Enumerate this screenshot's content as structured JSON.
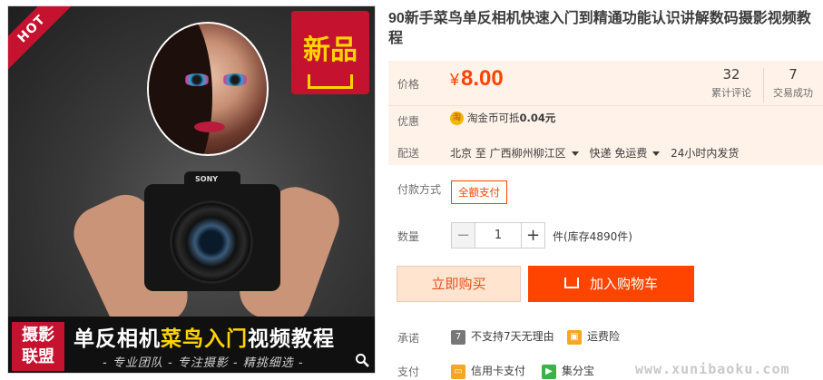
{
  "image": {
    "hot_label": "HOT",
    "new_label": "新品",
    "camera_brand": "SONY",
    "banner_tag": [
      "摄影",
      "联盟"
    ],
    "banner_title_white_1": "单反相机",
    "banner_title_yellow": "菜鸟入门",
    "banner_title_white_2": "视频教程",
    "banner_subtitle": "- 专业团队 - 专注摄影 - 精挑细选 -"
  },
  "product": {
    "title": "90新手菜鸟单反相机快速入门到精通功能认识讲解数码摄影视频教程"
  },
  "price": {
    "label": "价格",
    "currency": "¥",
    "amount": "8.00",
    "reviews_count": "32",
    "reviews_label": "累计评论",
    "sales_count": "7",
    "sales_label": "交易成功"
  },
  "promo": {
    "label": "优惠",
    "coin_icon_text": "淘",
    "text_prefix": "淘金币可抵",
    "text_amount": "0.04元"
  },
  "shipping": {
    "label": "配送",
    "from": "北京 至",
    "to": "广西柳州柳江区",
    "method": "快递 免运费",
    "dispatch": "24小时内发货"
  },
  "payment": {
    "label": "付款方式",
    "option": "全额支付"
  },
  "quantity": {
    "label": "数量",
    "value": "1",
    "minus": "−",
    "plus": "+",
    "stock": "件(库存4890件)"
  },
  "actions": {
    "buy_now": "立即购买",
    "add_to_cart": "加入购物车"
  },
  "promise": {
    "label": "承诺",
    "no_return_icon": "7",
    "no_return": "不支持7天无理由",
    "insurance": "运费险"
  },
  "pay_methods": {
    "label": "支付",
    "credit": "信用卡支付",
    "jifen": "集分宝"
  },
  "watermark": "www.xunibaoku.com",
  "colors": {
    "accent": "#ff4400",
    "price": "#ff4400",
    "price_bg": "#fff2e8"
  }
}
